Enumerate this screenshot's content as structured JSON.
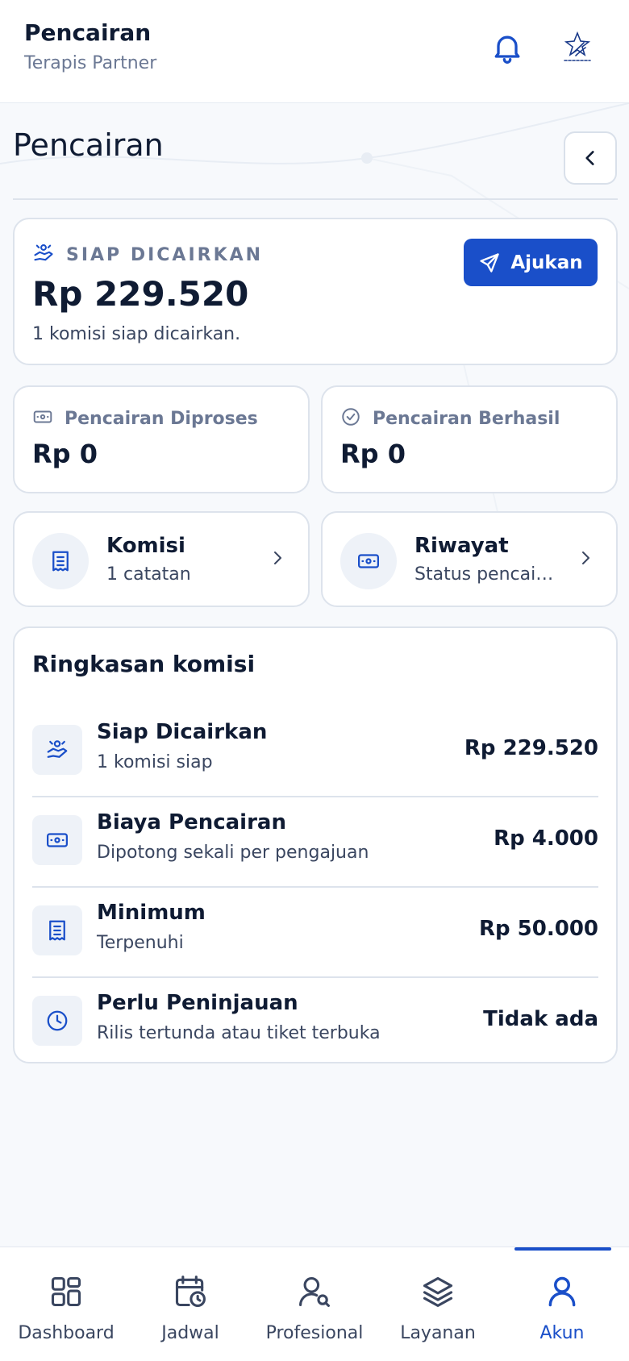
{
  "header": {
    "title": "Pencairan",
    "subtitle": "Terapis Partner"
  },
  "page": {
    "heading": "Pencairan"
  },
  "ready": {
    "label": "SIAP DICAIRKAN",
    "amount": "Rp 229.520",
    "note": "1 komisi siap dicairkan.",
    "button_label": "Ajukan"
  },
  "stats": [
    {
      "label": "Pencairan Diproses",
      "value": "Rp 0"
    },
    {
      "label": "Pencairan Berhasil",
      "value": "Rp 0"
    }
  ],
  "nav_cards": [
    {
      "title": "Komisi",
      "subtitle": "1 catatan"
    },
    {
      "title": "Riwayat",
      "subtitle": "Status pencairan"
    }
  ],
  "summary": {
    "heading": "Ringkasan komisi",
    "rows": [
      {
        "title": "Siap Dicairkan",
        "subtitle": "1 komisi siap",
        "value": "Rp 229.520",
        "icon": "hand-money-icon"
      },
      {
        "title": "Biaya Pencairan",
        "subtitle": "Dipotong sekali per pengajuan",
        "value": "Rp 4.000",
        "icon": "banknote-icon"
      },
      {
        "title": "Minimum",
        "subtitle": "Terpenuhi",
        "value": "Rp 50.000",
        "icon": "receipt-icon"
      },
      {
        "title": "Perlu Peninjauan",
        "subtitle": "Rilis tertunda atau tiket terbuka",
        "value": "Tidak ada",
        "icon": "clock-icon"
      }
    ]
  },
  "bottom_nav": [
    {
      "label": "Dashboard",
      "icon": "grid-icon",
      "active": false
    },
    {
      "label": "Jadwal",
      "icon": "calendar-clock-icon",
      "active": false
    },
    {
      "label": "Profesional",
      "icon": "user-search-icon",
      "active": false
    },
    {
      "label": "Layanan",
      "icon": "layers-icon",
      "active": false
    },
    {
      "label": "Akun",
      "icon": "user-icon",
      "active": true
    }
  ],
  "colors": {
    "accent": "#1a4fc9",
    "text": "#0f1b33",
    "muted": "#6b7894",
    "background": "#f7f9fc"
  }
}
